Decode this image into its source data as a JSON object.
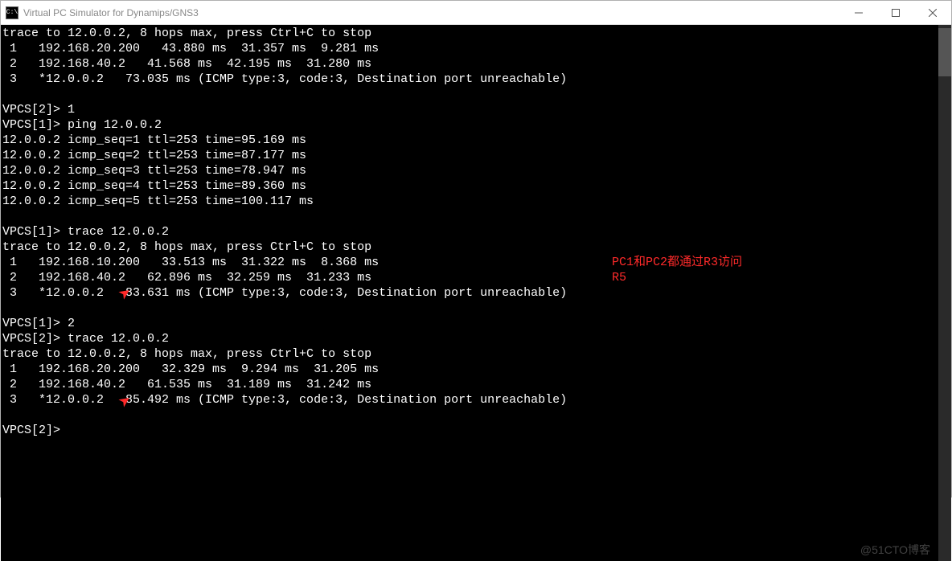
{
  "window": {
    "title": "Virtual PC Simulator for Dynamips/GNS3",
    "icon_label": "C:\\"
  },
  "terminal": {
    "lines": [
      "trace to 12.0.0.2, 8 hops max, press Ctrl+C to stop",
      " 1   192.168.20.200   43.880 ms  31.357 ms  9.281 ms",
      " 2   192.168.40.2   41.568 ms  42.195 ms  31.280 ms",
      " 3   *12.0.0.2   73.035 ms (ICMP type:3, code:3, Destination port unreachable)",
      "",
      "VPCS[2]> 1",
      "VPCS[1]> ping 12.0.0.2",
      "12.0.0.2 icmp_seq=1 ttl=253 time=95.169 ms",
      "12.0.0.2 icmp_seq=2 ttl=253 time=87.177 ms",
      "12.0.0.2 icmp_seq=3 ttl=253 time=78.947 ms",
      "12.0.0.2 icmp_seq=4 ttl=253 time=89.360 ms",
      "12.0.0.2 icmp_seq=5 ttl=253 time=100.117 ms",
      "",
      "VPCS[1]> trace 12.0.0.2",
      "trace to 12.0.0.2, 8 hops max, press Ctrl+C to stop",
      " 1   192.168.10.200   33.513 ms  31.322 ms  8.368 ms",
      " 2   192.168.40.2   62.896 ms  32.259 ms  31.233 ms",
      " 3   *12.0.0.2   83.631 ms (ICMP type:3, code:3, Destination port unreachable)",
      "",
      "VPCS[1]> 2",
      "VPCS[2]> trace 12.0.0.2",
      "trace to 12.0.0.2, 8 hops max, press Ctrl+C to stop",
      " 1   192.168.20.200   32.329 ms  9.294 ms  31.205 ms",
      " 2   192.168.40.2   61.535 ms  31.189 ms  31.242 ms",
      " 3   *12.0.0.2   85.492 ms (ICMP type:3, code:3, Destination port unreachable)",
      "",
      "VPCS[2]>"
    ]
  },
  "annotation": {
    "line1": "PC1和PC2都通过R3访问",
    "line2": "R5"
  },
  "watermark": "@51CTO博客"
}
